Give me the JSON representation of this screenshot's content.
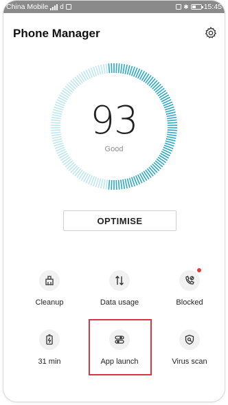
{
  "status_bar": {
    "carrier": "China Mobile",
    "time": "15:45"
  },
  "header": {
    "title": "Phone Manager",
    "settings_icon": "gear-icon"
  },
  "score": {
    "value": "93",
    "label": "Good"
  },
  "optimise_button": "OPTIMISE",
  "tools": [
    {
      "label": "Cleanup",
      "icon": "broom-icon"
    },
    {
      "label": "Data usage",
      "icon": "data-arrows-icon"
    },
    {
      "label": "Blocked",
      "icon": "blocked-call-icon",
      "badge": true
    },
    {
      "label": "31 min",
      "icon": "battery-icon"
    },
    {
      "label": "App launch",
      "icon": "app-launch-icon"
    },
    {
      "label": "Virus scan",
      "icon": "virus-scan-icon"
    }
  ],
  "colors": {
    "gauge_dark": "#2ba8c4",
    "gauge_light": "#bde6ef",
    "highlight": "#d9363e",
    "badge": "#e53935"
  }
}
